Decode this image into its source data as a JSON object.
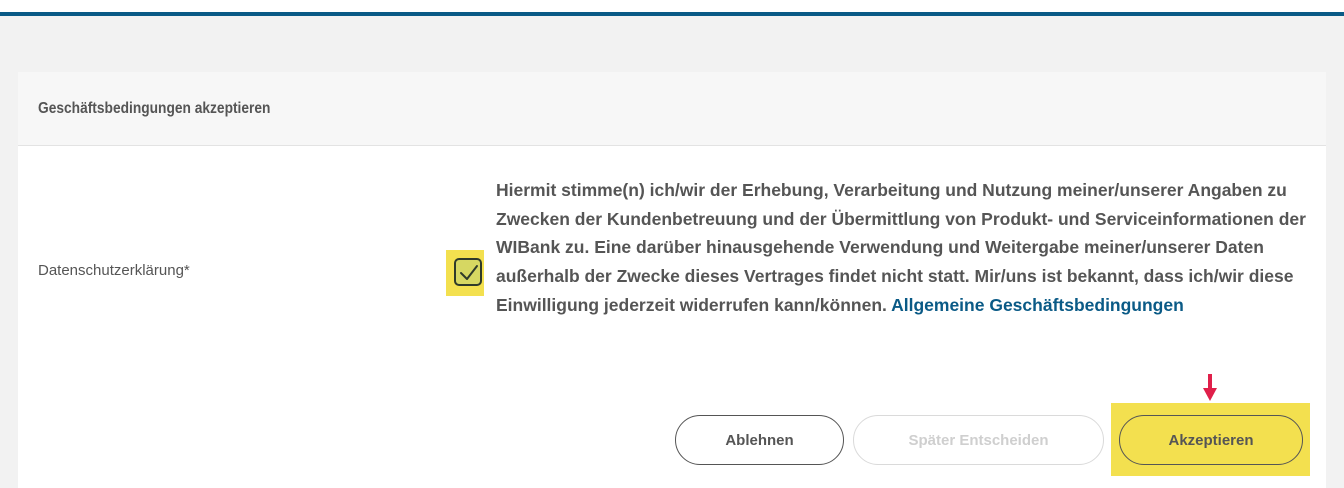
{
  "card": {
    "title": "Geschäftsbedingungen akzeptieren"
  },
  "field": {
    "label": "Datenschutzerklärung*",
    "checked": true
  },
  "consent": {
    "text": "Hiermit stimme(n) ich/wir der Erhebung, Verarbeitung und Nutzung meiner/unserer Angaben zu Zwecken der Kundenbetreuung und der Übermittlung von Produkt- und Serviceinformationen der WIBank zu. Eine darüber hinausgehende Verwendung und Weitergabe meiner/unserer Daten außerhalb der Zwecke dieses Vertrages findet nicht statt. Mir/uns ist bekannt, dass ich/wir diese Einwilligung jederzeit widerrufen kann/können.",
    "link_label": "Allgemeine Geschäftsbedingungen"
  },
  "buttons": {
    "reject_label": "Ablehnen",
    "later_label": "Später Entscheiden",
    "accept_label": "Akzeptieren"
  },
  "colors": {
    "accent": "#0a5a86",
    "highlight": "#f3e04f",
    "arrow": "#e0204a"
  },
  "icons": {
    "checkbox": "check-icon",
    "annotation": "down-arrow-icon"
  }
}
